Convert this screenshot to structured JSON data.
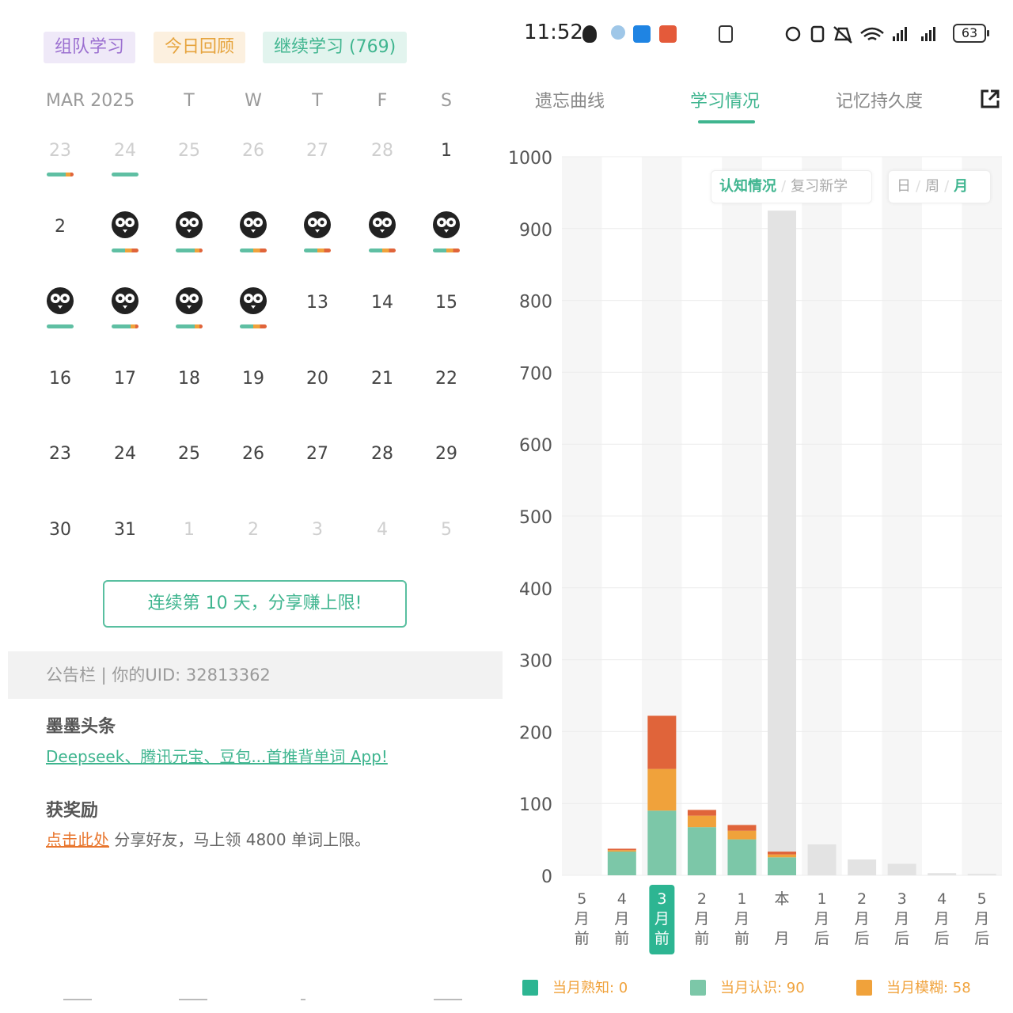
{
  "left": {
    "chips": {
      "team": "组队学习",
      "review": "今日回顾",
      "continue": "继续学习 (769)"
    },
    "calendar": {
      "month": "MAR 2025",
      "weekdays": [
        "T",
        "W",
        "T",
        "F",
        "S"
      ],
      "rows": [
        [
          "23",
          "24",
          "25",
          "26",
          "27",
          "28",
          "1"
        ],
        [
          "2",
          "",
          "",
          "",
          "",
          "",
          ""
        ],
        [
          "",
          "",
          "",
          "",
          "13",
          "14",
          "15"
        ],
        [
          "16",
          "17",
          "18",
          "19",
          "20",
          "21",
          "22"
        ],
        [
          "23",
          "24",
          "25",
          "26",
          "27",
          "28",
          "29"
        ],
        [
          "30",
          "31",
          "1",
          "2",
          "3",
          "4",
          "5"
        ]
      ]
    },
    "streak_button": "连续第 10 天，分享赚上限!",
    "notice": "公告栏 | 你的UID:  32813362",
    "headline_title": "墨墨头条",
    "headline_link": "Deepseek、腾讯元宝、豆包...首推背单词 App!",
    "reward_title": "获奖励",
    "reward_link": "点击此处",
    "reward_text": " 分享好友，马上领 4800 单词上限。"
  },
  "right": {
    "status": {
      "time": "11:52",
      "battery": "63"
    },
    "tabs": [
      "遗忘曲线",
      "学习情况",
      "记忆持久度"
    ],
    "active_tab": 1,
    "toggle_mode": [
      "认知情况",
      "复习新学"
    ],
    "toggle_period": [
      "日",
      "周",
      "月"
    ],
    "legend": [
      {
        "label": "当月熟知:  0",
        "color": "#2db592"
      },
      {
        "label": "当月认识:  90",
        "color": "#7cc7a8"
      },
      {
        "label": "当月模糊:  58",
        "color": "#f0a23b"
      }
    ]
  },
  "chart_data": {
    "type": "bar",
    "ylim": [
      0,
      1000
    ],
    "yticks": [
      0,
      100,
      200,
      300,
      400,
      500,
      600,
      700,
      800,
      900,
      1000
    ],
    "categories": [
      "5月前",
      "4月前",
      "3月前",
      "2月前",
      "1月前",
      "本月",
      "1月后",
      "2月后",
      "3月后",
      "4月后",
      "5月后"
    ],
    "selected_index": 2,
    "series": [
      {
        "values": [
          0,
          33,
          90,
          67,
          50,
          25,
          0,
          0,
          0,
          0,
          0
        ],
        "color": "#7cc7a8"
      },
      {
        "values": [
          0,
          2,
          58,
          16,
          12,
          4,
          0,
          0,
          0,
          0,
          0
        ],
        "color": "#f0a23b"
      },
      {
        "values": [
          0,
          2,
          74,
          8,
          8,
          4,
          0,
          0,
          0,
          0,
          0
        ],
        "color": "#e0643a"
      },
      {
        "values": [
          0,
          0,
          0,
          0,
          0,
          892,
          43,
          22,
          16,
          3,
          2
        ],
        "color": "#e3e3e3"
      }
    ]
  }
}
